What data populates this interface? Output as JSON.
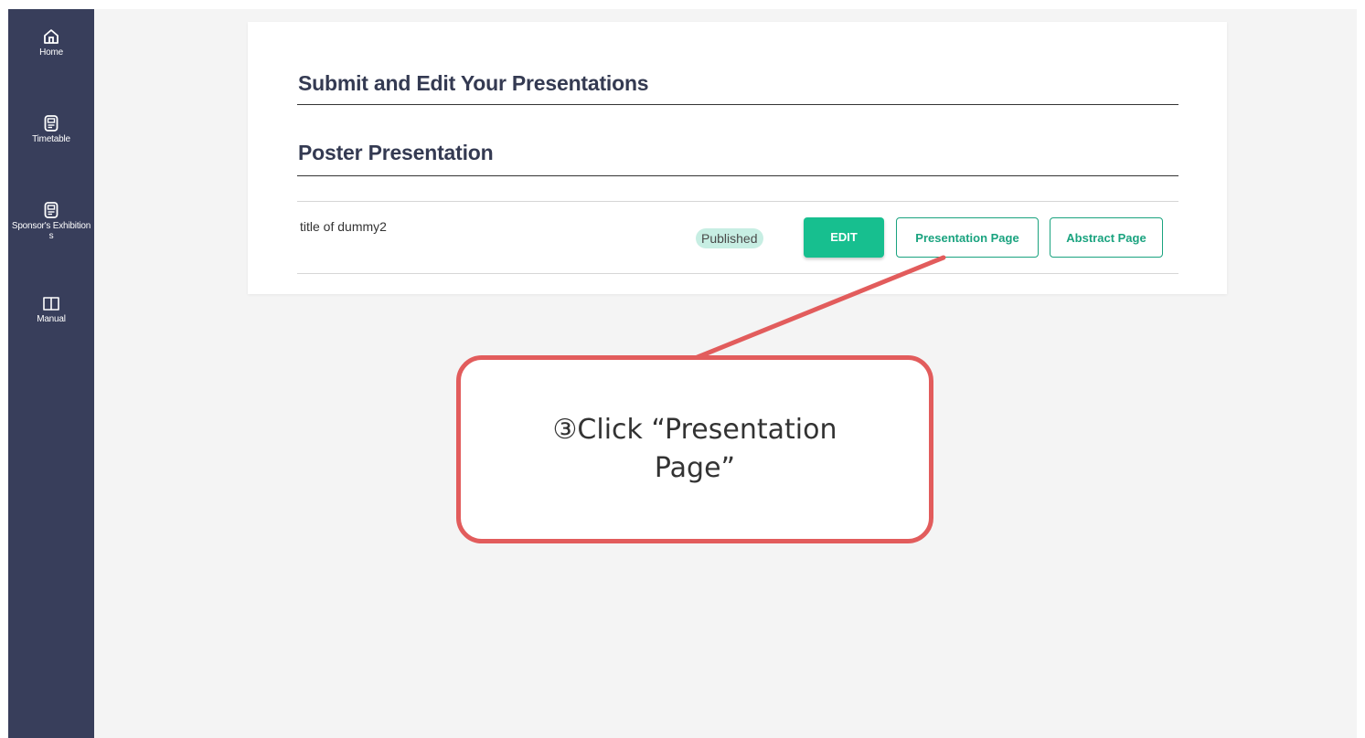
{
  "sidebar": {
    "items": [
      {
        "label": "Home",
        "icon": "home-icon"
      },
      {
        "label": "Timetable",
        "icon": "document-icon"
      },
      {
        "label": "Sponsor's Exhibitions",
        "icon": "document-icon"
      },
      {
        "label": "Manual",
        "icon": "book-icon"
      }
    ]
  },
  "main": {
    "page_title": "Submit and Edit Your Presentations",
    "section_title": "Poster Presentation",
    "row": {
      "title": "title of dummy2",
      "status": "Published",
      "edit_label": "EDIT",
      "presentation_page_label": "Presentation Page",
      "abstract_page_label": "Abstract Page"
    }
  },
  "callout": {
    "text": "③Click “Presentation Page”"
  },
  "colors": {
    "sidebar_bg": "#383e5b",
    "accent_green": "#17bf8f",
    "badge_bg": "#c7eee3",
    "callout_red": "#e25c5c",
    "page_bg": "#f4f4f4"
  }
}
